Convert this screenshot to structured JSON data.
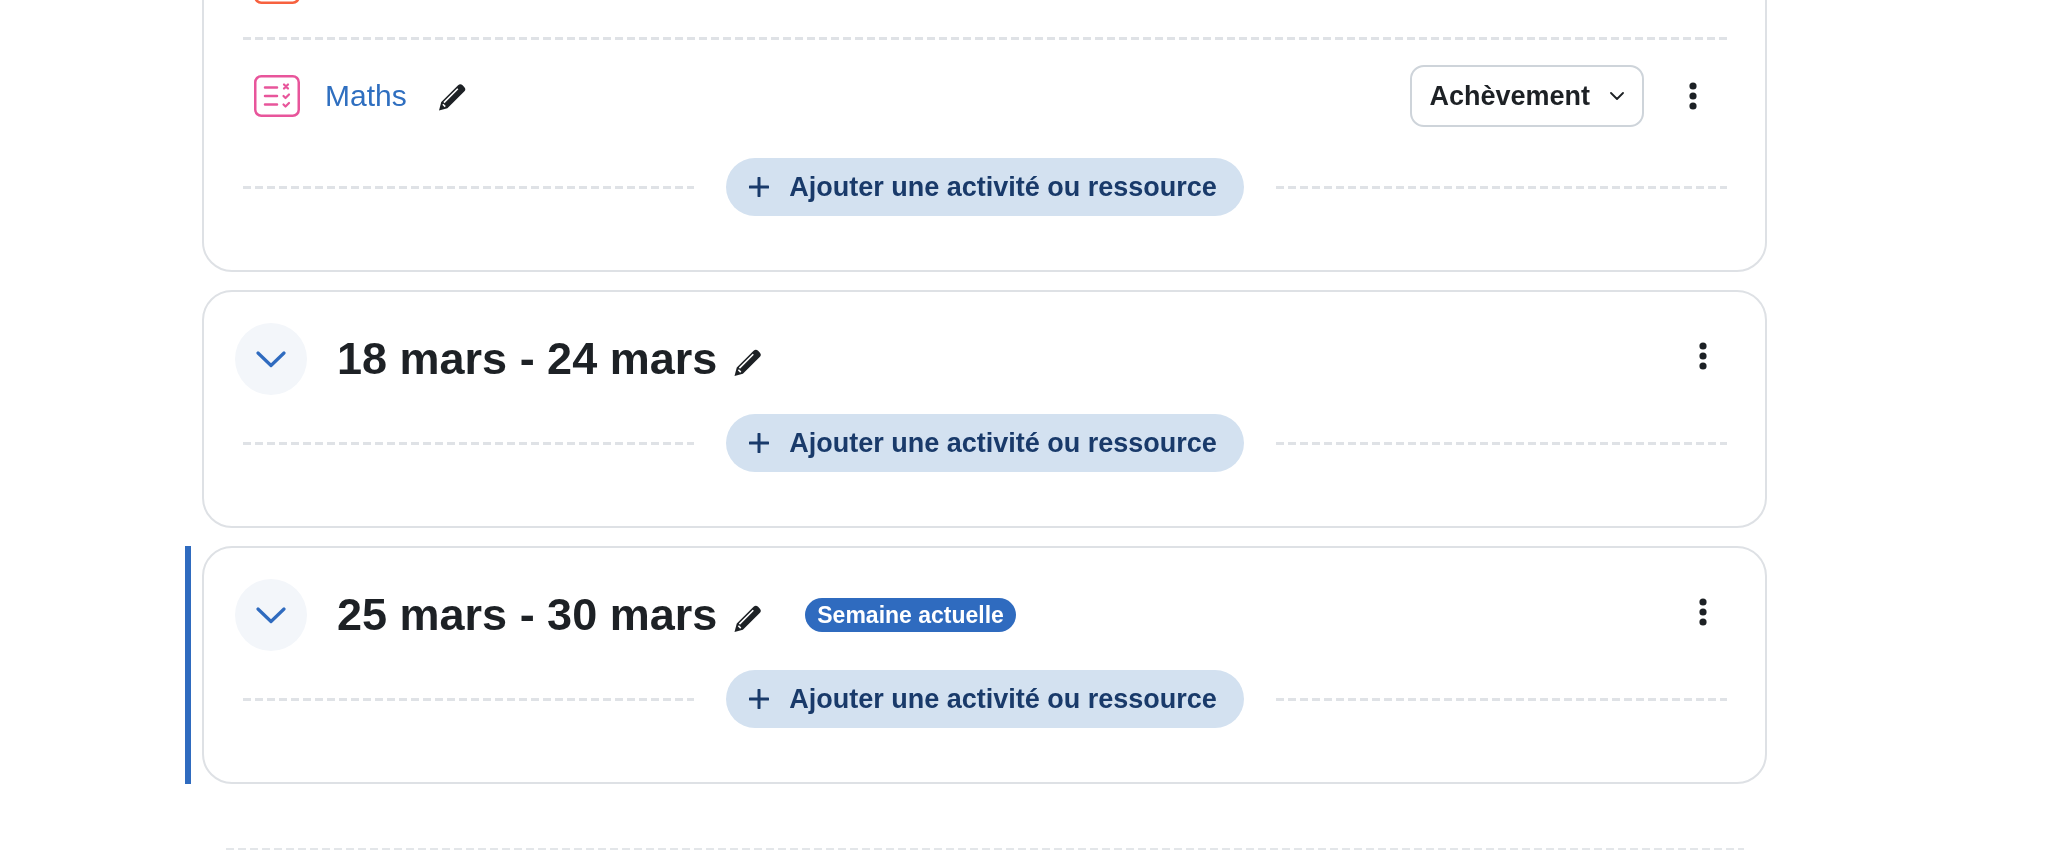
{
  "top_section": {
    "activities": [
      {
        "color": "#f7613f"
      },
      {
        "name": "Maths",
        "color": "#e8559b",
        "completion": "Achèvement"
      }
    ],
    "add_button": "Ajouter une activité ou ressource"
  },
  "sections": [
    {
      "title": "18 mars - 24 mars",
      "expanded": true,
      "current": false,
      "add_button": "Ajouter une activité ou ressource"
    },
    {
      "title": "25 mars - 30 mars",
      "expanded": true,
      "current": true,
      "badge": "Semaine actuelle",
      "add_button": "Ajouter une activité ou ressource"
    }
  ]
}
